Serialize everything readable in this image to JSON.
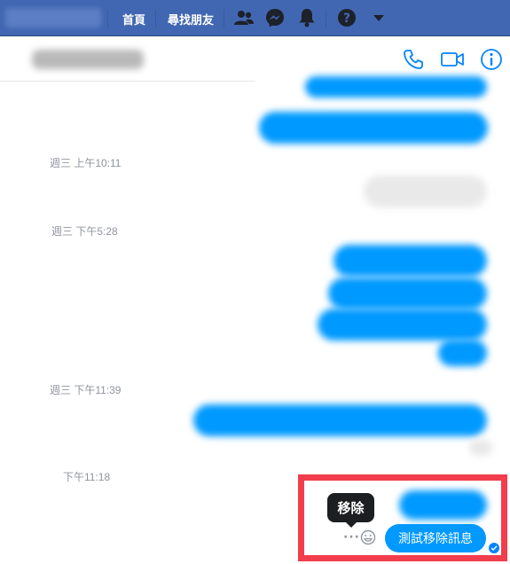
{
  "topbar": {
    "nav_home": "首頁",
    "nav_find_friends": "尋找朋友",
    "icons": [
      "friends-icon",
      "messenger-icon",
      "notifications-icon",
      "help-icon",
      "dropdown-icon"
    ]
  },
  "conversation": {
    "header_icons": [
      "phone-icon",
      "video-icon",
      "info-icon"
    ]
  },
  "timestamps": {
    "t1": "週三 上午10:11",
    "t2": "週三 下午5:28",
    "t3": "週三 下午11:39",
    "t4": "下午11:18"
  },
  "selected_message": {
    "tooltip": "移除",
    "more": "···",
    "text": "測試移除訊息"
  },
  "colors": {
    "topbar": "#4267b2",
    "bubble": "#0099ff",
    "highlight": "#f23d4c",
    "tooltip": "#1c1e21"
  }
}
